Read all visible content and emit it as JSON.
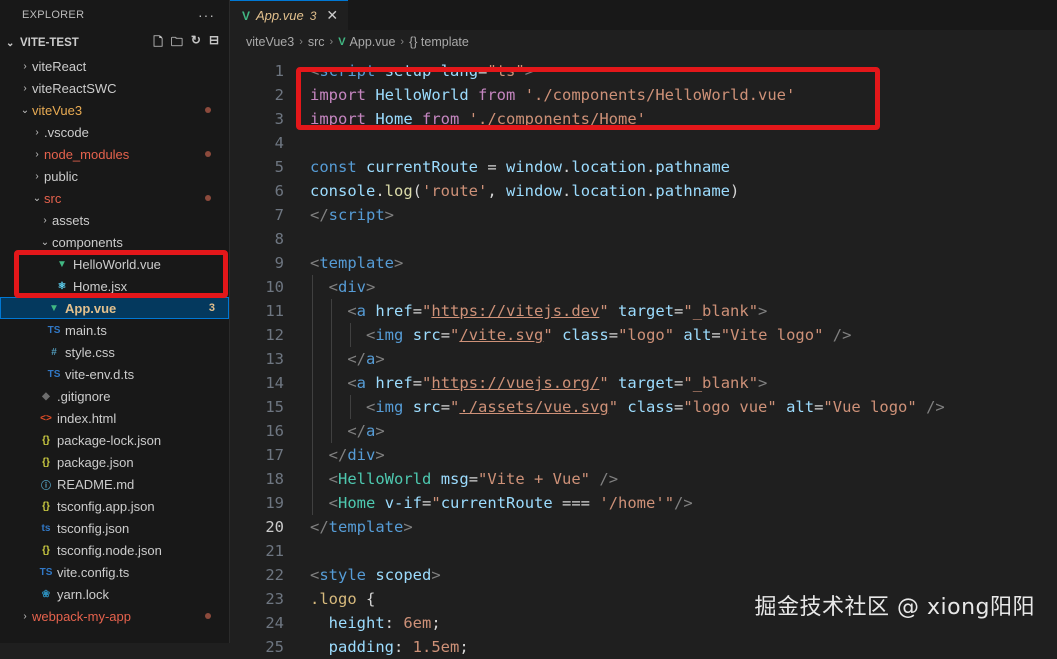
{
  "explorer": {
    "title": "EXPLORER",
    "more": "···",
    "workspace": "VITE-TEST"
  },
  "tree": [
    {
      "name": "viteReact",
      "type": "folder",
      "expanded": false,
      "depth": 1
    },
    {
      "name": "viteReactSWC",
      "type": "folder",
      "expanded": false,
      "depth": 1
    },
    {
      "name": "viteVue3",
      "type": "folder",
      "expanded": true,
      "depth": 1,
      "status": "modified"
    },
    {
      "name": ".vscode",
      "type": "folder",
      "expanded": false,
      "depth": 2
    },
    {
      "name": "node_modules",
      "type": "folder",
      "expanded": false,
      "depth": 2,
      "status": "ignored"
    },
    {
      "name": "public",
      "type": "folder",
      "expanded": false,
      "depth": 2
    },
    {
      "name": "src",
      "type": "folder",
      "expanded": true,
      "depth": 2,
      "status": "ignored"
    },
    {
      "name": "assets",
      "type": "folder",
      "expanded": false,
      "depth": 3
    },
    {
      "name": "components",
      "type": "folder",
      "expanded": true,
      "depth": 3
    },
    {
      "name": "HelloWorld.vue",
      "type": "file",
      "icon": "vue",
      "depth": 4
    },
    {
      "name": "Home.jsx",
      "type": "file",
      "icon": "react",
      "depth": 4
    },
    {
      "name": "App.vue",
      "type": "file",
      "icon": "vue",
      "depth": 3,
      "selected": true,
      "badge": "3"
    },
    {
      "name": "main.ts",
      "type": "file",
      "icon": "ts",
      "depth": 3
    },
    {
      "name": "style.css",
      "type": "file",
      "icon": "css",
      "depth": 3
    },
    {
      "name": "vite-env.d.ts",
      "type": "file",
      "icon": "ts",
      "depth": 3
    },
    {
      "name": ".gitignore",
      "type": "file",
      "icon": "git",
      "depth": 2
    },
    {
      "name": "index.html",
      "type": "file",
      "icon": "html",
      "depth": 2
    },
    {
      "name": "package-lock.json",
      "type": "file",
      "icon": "json",
      "depth": 2
    },
    {
      "name": "package.json",
      "type": "file",
      "icon": "json",
      "depth": 2
    },
    {
      "name": "README.md",
      "type": "file",
      "icon": "info",
      "depth": 2
    },
    {
      "name": "tsconfig.app.json",
      "type": "file",
      "icon": "json",
      "depth": 2
    },
    {
      "name": "tsconfig.json",
      "type": "file",
      "icon": "tsconfig",
      "depth": 2
    },
    {
      "name": "tsconfig.node.json",
      "type": "file",
      "icon": "json",
      "depth": 2
    },
    {
      "name": "vite.config.ts",
      "type": "file",
      "icon": "ts",
      "depth": 2
    },
    {
      "name": "yarn.lock",
      "type": "file",
      "icon": "yarn",
      "depth": 2
    },
    {
      "name": "webpack-my-app",
      "type": "folder",
      "expanded": false,
      "depth": 1,
      "status": "ignored"
    }
  ],
  "tab": {
    "name": "App.vue",
    "problems": "3",
    "close": "✕"
  },
  "breadcrumb": [
    "viteVue3",
    "src",
    "App.vue",
    "{} template"
  ],
  "active_line": 20,
  "code_lines": [
    [
      [
        "tk-punct",
        "<"
      ],
      [
        "tk-tag",
        "script"
      ],
      [
        "tk-txt",
        " "
      ],
      [
        "tk-attr",
        "setup"
      ],
      [
        "tk-txt",
        " "
      ],
      [
        "tk-attr",
        "lang"
      ],
      [
        "tk-txt",
        "="
      ],
      [
        "tk-str",
        "\"ts\""
      ],
      [
        "tk-punct",
        ">"
      ]
    ],
    [
      [
        "tk-kw",
        "import"
      ],
      [
        "tk-txt",
        " "
      ],
      [
        "tk-var",
        "HelloWorld"
      ],
      [
        "tk-txt",
        " "
      ],
      [
        "tk-kw",
        "from"
      ],
      [
        "tk-txt",
        " "
      ],
      [
        "tk-str",
        "'./components/HelloWorld.vue'"
      ]
    ],
    [
      [
        "tk-kw",
        "import"
      ],
      [
        "tk-txt",
        " "
      ],
      [
        "tk-var",
        "Home"
      ],
      [
        "tk-txt",
        " "
      ],
      [
        "tk-kw",
        "from"
      ],
      [
        "tk-txt",
        " "
      ],
      [
        "tk-str",
        "'./components/Home'"
      ]
    ],
    [],
    [
      [
        "tk-kw2",
        "const"
      ],
      [
        "tk-txt",
        " "
      ],
      [
        "tk-var",
        "currentRoute"
      ],
      [
        "tk-txt",
        " = "
      ],
      [
        "tk-var",
        "window"
      ],
      [
        "tk-txt",
        "."
      ],
      [
        "tk-var",
        "location"
      ],
      [
        "tk-txt",
        "."
      ],
      [
        "tk-var",
        "pathname"
      ]
    ],
    [
      [
        "tk-var",
        "console"
      ],
      [
        "tk-txt",
        "."
      ],
      [
        "tk-fn",
        "log"
      ],
      [
        "tk-txt",
        "("
      ],
      [
        "tk-str",
        "'route'"
      ],
      [
        "tk-txt",
        ", "
      ],
      [
        "tk-var",
        "window"
      ],
      [
        "tk-txt",
        "."
      ],
      [
        "tk-var",
        "location"
      ],
      [
        "tk-txt",
        "."
      ],
      [
        "tk-var",
        "pathname"
      ],
      [
        "tk-txt",
        ")"
      ]
    ],
    [
      [
        "tk-punct",
        "</"
      ],
      [
        "tk-tag",
        "script"
      ],
      [
        "tk-punct",
        ">"
      ]
    ],
    [],
    [
      [
        "tk-punct",
        "<"
      ],
      [
        "tk-tag",
        "template"
      ],
      [
        "tk-punct",
        ">"
      ]
    ],
    [
      [
        "tk-txt",
        "  "
      ],
      [
        "tk-punct",
        "<"
      ],
      [
        "tk-tag",
        "div"
      ],
      [
        "tk-punct",
        ">"
      ]
    ],
    [
      [
        "tk-txt",
        "    "
      ],
      [
        "tk-punct",
        "<"
      ],
      [
        "tk-tag",
        "a"
      ],
      [
        "tk-txt",
        " "
      ],
      [
        "tk-attr",
        "href"
      ],
      [
        "tk-txt",
        "="
      ],
      [
        "tk-str",
        "\""
      ],
      [
        "tk-str ul",
        "https://vitejs.dev"
      ],
      [
        "tk-str",
        "\""
      ],
      [
        "tk-txt",
        " "
      ],
      [
        "tk-attr",
        "target"
      ],
      [
        "tk-txt",
        "="
      ],
      [
        "tk-str",
        "\"_blank\""
      ],
      [
        "tk-punct",
        ">"
      ]
    ],
    [
      [
        "tk-txt",
        "      "
      ],
      [
        "tk-punct",
        "<"
      ],
      [
        "tk-tag",
        "img"
      ],
      [
        "tk-txt",
        " "
      ],
      [
        "tk-attr",
        "src"
      ],
      [
        "tk-txt",
        "="
      ],
      [
        "tk-str",
        "\""
      ],
      [
        "tk-str ul",
        "/vite.svg"
      ],
      [
        "tk-str",
        "\""
      ],
      [
        "tk-txt",
        " "
      ],
      [
        "tk-attr",
        "class"
      ],
      [
        "tk-txt",
        "="
      ],
      [
        "tk-str",
        "\"logo\""
      ],
      [
        "tk-txt",
        " "
      ],
      [
        "tk-attr",
        "alt"
      ],
      [
        "tk-txt",
        "="
      ],
      [
        "tk-str",
        "\"Vite logo\""
      ],
      [
        "tk-txt",
        " "
      ],
      [
        "tk-punct",
        "/>"
      ]
    ],
    [
      [
        "tk-txt",
        "    "
      ],
      [
        "tk-punct",
        "</"
      ],
      [
        "tk-tag",
        "a"
      ],
      [
        "tk-punct",
        ">"
      ]
    ],
    [
      [
        "tk-txt",
        "    "
      ],
      [
        "tk-punct",
        "<"
      ],
      [
        "tk-tag",
        "a"
      ],
      [
        "tk-txt",
        " "
      ],
      [
        "tk-attr",
        "href"
      ],
      [
        "tk-txt",
        "="
      ],
      [
        "tk-str",
        "\""
      ],
      [
        "tk-str ul",
        "https://vuejs.org/"
      ],
      [
        "tk-str",
        "\""
      ],
      [
        "tk-txt",
        " "
      ],
      [
        "tk-attr",
        "target"
      ],
      [
        "tk-txt",
        "="
      ],
      [
        "tk-str",
        "\"_blank\""
      ],
      [
        "tk-punct",
        ">"
      ]
    ],
    [
      [
        "tk-txt",
        "      "
      ],
      [
        "tk-punct",
        "<"
      ],
      [
        "tk-tag",
        "img"
      ],
      [
        "tk-txt",
        " "
      ],
      [
        "tk-attr",
        "src"
      ],
      [
        "tk-txt",
        "="
      ],
      [
        "tk-str",
        "\""
      ],
      [
        "tk-str ul",
        "./assets/vue.svg"
      ],
      [
        "tk-str",
        "\""
      ],
      [
        "tk-txt",
        " "
      ],
      [
        "tk-attr",
        "class"
      ],
      [
        "tk-txt",
        "="
      ],
      [
        "tk-str",
        "\"logo vue\""
      ],
      [
        "tk-txt",
        " "
      ],
      [
        "tk-attr",
        "alt"
      ],
      [
        "tk-txt",
        "="
      ],
      [
        "tk-str",
        "\"Vue logo\""
      ],
      [
        "tk-txt",
        " "
      ],
      [
        "tk-punct",
        "/>"
      ]
    ],
    [
      [
        "tk-txt",
        "    "
      ],
      [
        "tk-punct",
        "</"
      ],
      [
        "tk-tag",
        "a"
      ],
      [
        "tk-punct",
        ">"
      ]
    ],
    [
      [
        "tk-txt",
        "  "
      ],
      [
        "tk-punct",
        "</"
      ],
      [
        "tk-tag",
        "div"
      ],
      [
        "tk-punct",
        ">"
      ]
    ],
    [
      [
        "tk-txt",
        "  "
      ],
      [
        "tk-punct",
        "<"
      ],
      [
        "tk-comp",
        "HelloWorld"
      ],
      [
        "tk-txt",
        " "
      ],
      [
        "tk-attr",
        "msg"
      ],
      [
        "tk-txt",
        "="
      ],
      [
        "tk-str",
        "\"Vite + Vue\""
      ],
      [
        "tk-txt",
        " "
      ],
      [
        "tk-punct",
        "/>"
      ]
    ],
    [
      [
        "tk-txt",
        "  "
      ],
      [
        "tk-punct",
        "<"
      ],
      [
        "tk-comp",
        "Home"
      ],
      [
        "tk-txt",
        " "
      ],
      [
        "tk-attr",
        "v-if"
      ],
      [
        "tk-txt",
        "="
      ],
      [
        "tk-str",
        "\""
      ],
      [
        "tk-var",
        "currentRoute"
      ],
      [
        "tk-txt",
        " === "
      ],
      [
        "tk-str",
        "'/home'"
      ],
      [
        "tk-str",
        "\""
      ],
      [
        "tk-punct",
        "/>"
      ]
    ],
    [
      [
        "tk-punct",
        "</"
      ],
      [
        "tk-tag",
        "template"
      ],
      [
        "tk-punct",
        ">"
      ]
    ],
    [],
    [
      [
        "tk-punct",
        "<"
      ],
      [
        "tk-tag",
        "style"
      ],
      [
        "tk-txt",
        " "
      ],
      [
        "tk-attr",
        "scoped"
      ],
      [
        "tk-punct",
        ">"
      ]
    ],
    [
      [
        "tk-sel",
        ".logo"
      ],
      [
        "tk-txt",
        " {"
      ]
    ],
    [
      [
        "tk-txt",
        "  "
      ],
      [
        "tk-attr",
        "height"
      ],
      [
        "tk-txt",
        ": "
      ],
      [
        "tk-str",
        "6em"
      ],
      [
        "tk-txt",
        ";"
      ]
    ],
    [
      [
        "tk-txt",
        "  "
      ],
      [
        "tk-attr",
        "padding"
      ],
      [
        "tk-txt",
        ": "
      ],
      [
        "tk-str",
        "1.5em"
      ],
      [
        "tk-txt",
        ";"
      ]
    ]
  ],
  "watermark": "掘金技术社区 @ xiong阳阳",
  "colors": {
    "accent": "#0078d4",
    "highlight_box": "#e3171a",
    "vue_green": "#41b883"
  }
}
